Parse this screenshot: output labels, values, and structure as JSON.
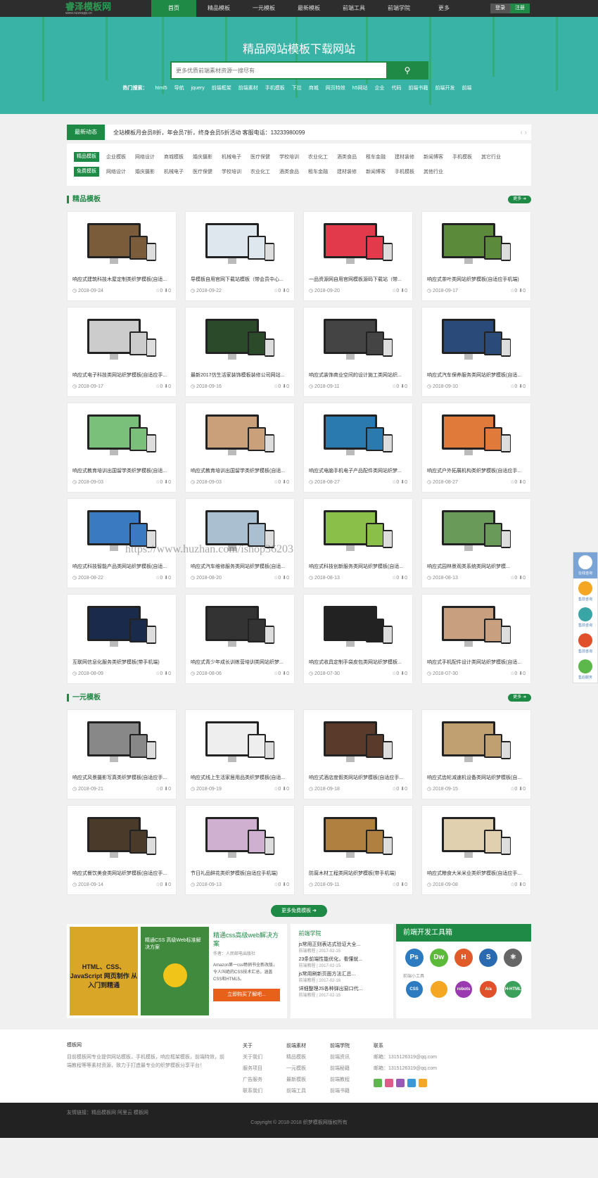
{
  "header": {
    "logo": "睿泽模板网",
    "logo_sub": "www.ruizeapp.cn",
    "nav": [
      "首页",
      "精品模板",
      "一元模板",
      "最新模板",
      "前端工具",
      "前端学院",
      "更多"
    ],
    "login": "登录",
    "register": "注册"
  },
  "banner": {
    "title": "精品网站模板下载网站",
    "search_placeholder": "更多优质前端素材资源一搜尽有",
    "hot_label": "热门搜索：",
    "hot": [
      "html5",
      "导航",
      "jquery",
      "前端框架",
      "前端素材",
      "手机模板",
      "下拉",
      "商城",
      "网页特效",
      "h5网站",
      "企业",
      "代码",
      "前端书籍",
      "前端开发",
      "前端"
    ]
  },
  "news": {
    "tag": "最新动态",
    "text": "全站模板月会员8折，年会员7折，终身会员5折活动 客服电话：13233980099"
  },
  "cats": {
    "row1_label": "精品模板",
    "row1": [
      "企业模板",
      "网络设计",
      "商城模板",
      "婚庆摄影",
      "机械电子",
      "医疗保健",
      "学校培训",
      "农业化工",
      "酒类食品",
      "租车金融",
      "建材装修",
      "新闻博客",
      "手机模板",
      "其它行业"
    ],
    "row2_label": "免费模板",
    "row2": [
      "网络设计",
      "婚庆摄影",
      "机械电子",
      "医疗保健",
      "学校培训",
      "农业化工",
      "酒类食品",
      "租车金融",
      "建材装修",
      "新闻博客",
      "手机模板",
      "其他行业"
    ]
  },
  "section1": {
    "title": "精品模板",
    "more": "更多 ➜",
    "items": [
      {
        "t": "响应式建筑科技木屋定制类织梦模板(自适...",
        "d": "2018-09-24",
        "c": "#7a5b3a"
      },
      {
        "t": "导模板自用官网下载站模板（带会员中心...",
        "d": "2018-09-22",
        "c": "#dfe7ee"
      },
      {
        "t": "一品资源网自用官网模板源码下载站（带...",
        "d": "2018-09-20",
        "c": "#e23a4a"
      },
      {
        "t": "响应式茶叶类网站织梦模板(自适应手机端)",
        "d": "2018-09-17",
        "c": "#5a8a3a"
      },
      {
        "t": "响应式电子科技类网站织梦模板(自适应手...",
        "d": "2018-09-17",
        "c": "#ccc"
      },
      {
        "t": "最新2017仿生活家装饰模板装修公司网站...",
        "d": "2018-09-16",
        "c": "#2a4a2a"
      },
      {
        "t": "响应式装饰商业空间的设计施工类网站织...",
        "d": "2018-09-11",
        "c": "#444"
      },
      {
        "t": "响应式汽车保养服务类网站织梦模板(自适...",
        "d": "2018-09-10",
        "c": "#2a4a7a"
      },
      {
        "t": "响应式教育培训出国留学类织梦模板(自适...",
        "d": "2018-09-03",
        "c": "#7ac07a"
      },
      {
        "t": "响应式教育培训出国留学类织梦模板(自适...",
        "d": "2018-09-03",
        "c": "#c9a07a"
      },
      {
        "t": "响应式电脑手机电子产品配件类网站织梦...",
        "d": "2018-08-27",
        "c": "#2a7ab0"
      },
      {
        "t": "响应式户外拓展机构类织梦模板(自适应手...",
        "d": "2018-08-27",
        "c": "#e07a3a"
      },
      {
        "t": "响应式科技智能产品类网站织梦模板(自适...",
        "d": "2018-08-22",
        "c": "#3a7ac0"
      },
      {
        "t": "响应式汽车维修服务类网站织梦模板(自适...",
        "d": "2018-08-20",
        "c": "#aac0d0"
      },
      {
        "t": "响应式科技创新服务类网站织梦模板(自适...",
        "d": "2018-08-13",
        "c": "#8ac04a"
      },
      {
        "t": "响应式园林景观类系统类网站织梦模...",
        "d": "2018-08-13",
        "c": "#6a9a5a"
      },
      {
        "t": "互联网信息化服务类织梦模板(带手机端)",
        "d": "2018-08-09",
        "c": "#1a2a4a"
      },
      {
        "t": "响应式青少年成长训练营培训类网站织梦...",
        "d": "2018-08-06",
        "c": "#333"
      },
      {
        "t": "响应式收具定制手袋皮包类网站织梦模板...",
        "d": "2018-07-30",
        "c": "#222"
      },
      {
        "t": "响应式手机配件设计类网站织梦模板(自适...",
        "d": "2018-07-30",
        "c": "#c8a080"
      }
    ]
  },
  "section2": {
    "title": "一元模板",
    "more": "更多 ➜",
    "items": [
      {
        "t": "响应式风景摄影写真类织梦模板(自适应手...",
        "d": "2018-09-21",
        "c": "#888"
      },
      {
        "t": "响应式线上生活家居用品类织梦模板(自适...",
        "d": "2018-09-19",
        "c": "#eee"
      },
      {
        "t": "响应式酒店度假类网站织梦模板(自适应手...",
        "d": "2018-09-18",
        "c": "#5a3a2a"
      },
      {
        "t": "响应式齿轮减速机设备类网站织梦模板(自...",
        "d": "2018-09-15",
        "c": "#c0a070"
      },
      {
        "t": "响应式餐饮美食类网站织梦模板(自适应手...",
        "d": "2018-09-14",
        "c": "#4a3a2a"
      },
      {
        "t": "节日礼品鲜花类织梦模板(自适应手机端)",
        "d": "2018-09-13",
        "c": "#d0b0d0"
      },
      {
        "t": "防腐木材工程类网站织梦模板(带手机端)",
        "d": "2018-09-11",
        "c": "#b08040"
      },
      {
        "t": "响应式粮食大米米业类织梦模板(自适应手...",
        "d": "2018-09-08",
        "c": "#e0d0b0"
      }
    ]
  },
  "more_free": "更多免费模板 ➜",
  "stats": "☆0 ⬇0",
  "book": {
    "cover1": "HTML、CSS、JavaScript 网页制作 从入门到精通",
    "cover2": "精通CSS 高级Web标准解决方案",
    "title": "精通css高级web解决方案",
    "author": "作者：人民邮电出版社",
    "desc": "Amazon第一css畅销书全新改版，令人叫绝的CSS技术汇总，涵盖CSS和HTML5。",
    "btn": "立即购买了解吧..."
  },
  "learn": {
    "title": "前端学院",
    "items": [
      {
        "t": "js常用正则表达式验证大全...",
        "d": "前端教程 | 2017-02-15"
      },
      {
        "t": "23条前端性能优化，看懂就...",
        "d": "前端教程 | 2017-02-15"
      },
      {
        "t": "js常用刷新页面方法汇总...",
        "d": "前端教程 | 2017-02-16"
      },
      {
        "t": "详细整理JS各种弹出窗口代...",
        "d": "前端教程 | 2017-02-15"
      }
    ]
  },
  "tools": {
    "title": "前端开发工具箱",
    "icons": [
      "Ps",
      "Dw",
      "H",
      "S",
      "⚛"
    ],
    "colors": [
      "#2c7bc0",
      "#5cba3a",
      "#e05a2a",
      "#2a6ab0",
      "#666"
    ],
    "small_label": "前端小工具",
    "small": [
      "CSS",
      "",
      "robots",
      "A/a",
      "H-HTML"
    ],
    "small_colors": [
      "#2c7bc0",
      "#f5a623",
      "#9b3ab0",
      "#e0502a",
      "#3aa05a"
    ]
  },
  "footer": {
    "about_title": "模板网",
    "about": "目前模板网专业提供网站模板，手机模板，响应框架模板，前端特效，前端教程等等素材资源，致力于打造最专业的织梦模板分享平台！",
    "cols": [
      {
        "h": "关于",
        "i": [
          "关于我们",
          "服务项目",
          "广告服务",
          "联系我们"
        ]
      },
      {
        "h": "前端素材",
        "i": [
          "精品模板",
          "一元模板",
          "最新模板",
          "前端工具"
        ]
      },
      {
        "h": "前端学院",
        "i": [
          "前端资讯",
          "前端秘籍",
          "前端教程",
          "前端书籍"
        ]
      },
      {
        "h": "联系",
        "i": [
          "邮箱：1315126319@qq.com",
          "邮箱：1315126319@qq.com"
        ]
      }
    ],
    "social_colors": [
      "#5cb84a",
      "#e05a8a",
      "#9b59b6",
      "#3a9ad9",
      "#f5a623"
    ],
    "links": "友情链接：精品模板网 阿里云 模板网",
    "copyright": "Copyright © 2018-2018 织梦模板网版权所有"
  },
  "side": [
    "在线咨询",
    "售前咨询",
    "售前咨询",
    "售前咨询",
    "售后服务"
  ],
  "watermark": "https://www.huzhan.com/ishop36203"
}
